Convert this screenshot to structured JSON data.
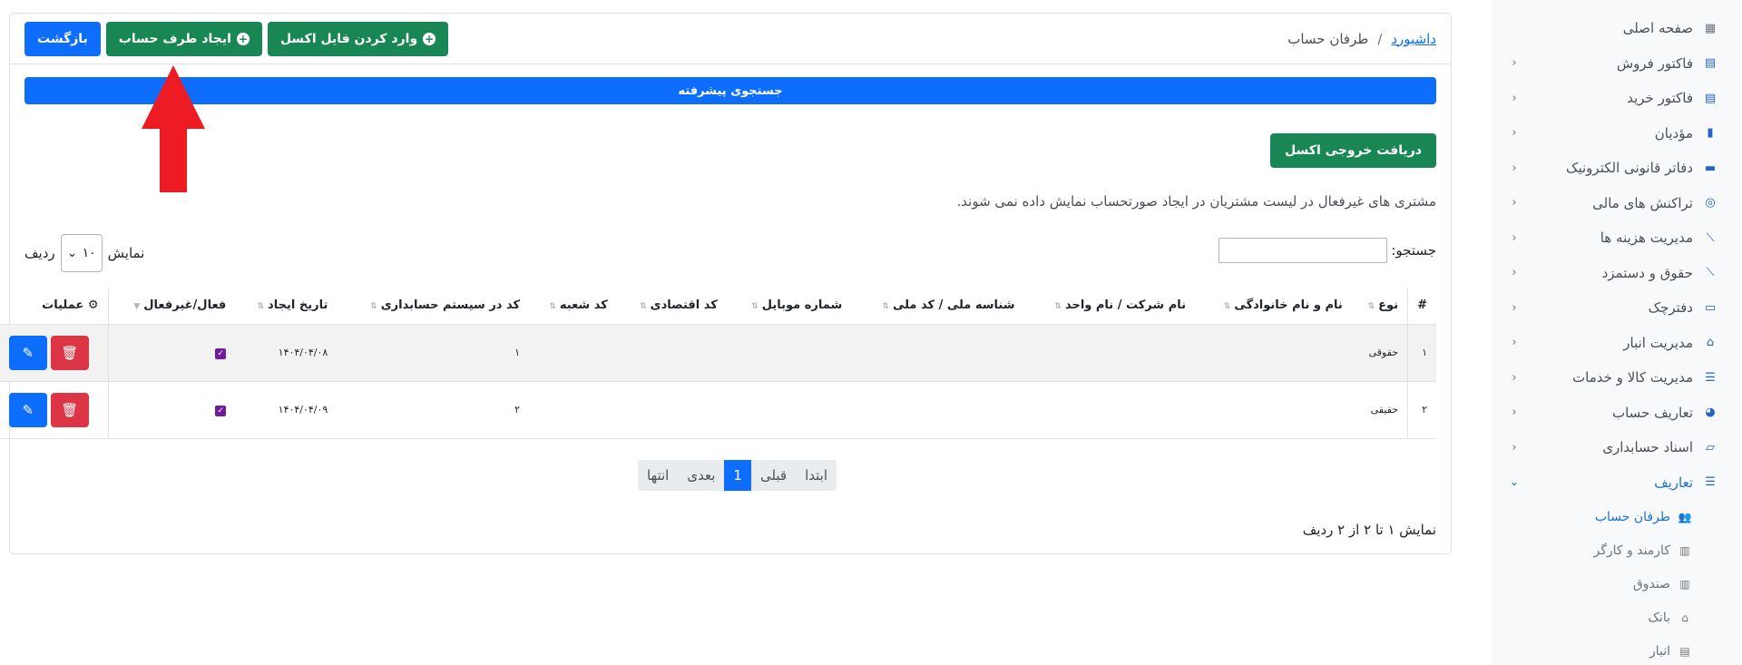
{
  "sidebar": {
    "items": [
      {
        "label": "صفحه اصلی",
        "icon": "grid-icon"
      },
      {
        "label": "فاکتور فروش",
        "icon": "invoice-icon"
      },
      {
        "label": "فاکتور خرید",
        "icon": "invoice-icon"
      },
      {
        "label": "مؤدیان",
        "icon": "chart-bar-icon"
      },
      {
        "label": "دفاتر قانونی الکترونیک",
        "icon": "book-icon"
      },
      {
        "label": "تراکنش های مالی",
        "icon": "coins-icon"
      },
      {
        "label": "مدیریت هزینه ها",
        "icon": "line-chart-icon"
      },
      {
        "label": "حقوق و دستمزد",
        "icon": "line-chart-icon"
      },
      {
        "label": "دفترچک",
        "icon": "money-icon"
      },
      {
        "label": "مدیریت انبار",
        "icon": "warehouse-icon"
      },
      {
        "label": "مدیریت کالا و خدمات",
        "icon": "list-icon"
      },
      {
        "label": "تعاریف حساب",
        "icon": "pie-chart-icon"
      },
      {
        "label": "اسناد حسابداری",
        "icon": "folder-icon"
      },
      {
        "label": "تعاریف",
        "icon": "list-icon"
      }
    ],
    "subitems": [
      {
        "label": "طرفان حساب",
        "icon": "users-icon"
      },
      {
        "label": "کارمند و کارگر",
        "icon": "register-icon"
      },
      {
        "label": "صندوق",
        "icon": "register-icon"
      },
      {
        "label": "بانک",
        "icon": "bank-icon"
      },
      {
        "label": "انبار",
        "icon": "warehouse-icon"
      }
    ]
  },
  "header": {
    "breadcrumb_home": "داشبورد",
    "breadcrumb_sep": "/",
    "breadcrumb_current": "طرفان حساب",
    "back_label": "بازگشت",
    "create_label": "ایجاد طرف حساب",
    "import_label": "وارد کردن فایل اکسل"
  },
  "advanced_search": "جستجوی پیشرفته",
  "export_excel": "دریافت خروجی اکسل",
  "notice": "مشتری های غیرفعال در لیست مشتریان در ایجاد صورتحساب نمایش داده نمی شوند.",
  "search": {
    "label": "جستجو:"
  },
  "length": {
    "show": "نمایش",
    "value": "۱۰",
    "rows": "ردیف"
  },
  "table": {
    "headers": {
      "num": "#",
      "type": "نوع",
      "name": "نام و نام خانوادگی",
      "company": "نام شرکت / نام واحد",
      "national": "شناسه ملی / کد ملی",
      "mobile": "شماره موبایل",
      "economic": "کد اقتصادی",
      "branch": "کد شعبه",
      "acc_code": "کد در سیستم حسابداری",
      "created": "تاریخ ایجاد",
      "active": "فعال/غیرفعال",
      "ops": "عملیات"
    },
    "rows": [
      {
        "num": "۱",
        "type": "حقوقی",
        "acc_code": "۱",
        "created": "۱۴۰۴/۰۴/۰۸"
      },
      {
        "num": "۲",
        "type": "حقیقی",
        "acc_code": "۲",
        "created": "۱۴۰۴/۰۴/۰۹"
      }
    ]
  },
  "pagination": {
    "first": "ابتدا",
    "prev": "قبلی",
    "current": "1",
    "next": "بعدی",
    "last": "انتها"
  },
  "info": "نمایش ۱ تا ۲ از ۲ ردیف",
  "colors": {
    "primary": "#0d6efd",
    "success": "#198754",
    "danger": "#dc3545",
    "arrow": "#ed1c24"
  }
}
